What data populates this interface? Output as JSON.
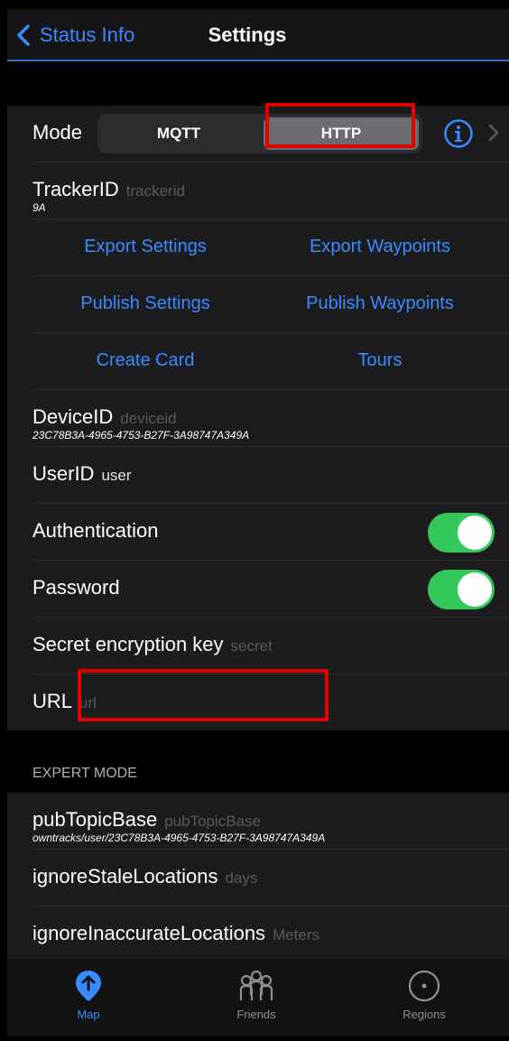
{
  "nav": {
    "back_label": "Status Info",
    "title": "Settings"
  },
  "mode": {
    "label": "Mode",
    "options": [
      "MQTT",
      "HTTP"
    ],
    "selected": "HTTP"
  },
  "tracker": {
    "label": "TrackerID",
    "placeholder": "trackerid",
    "value": "9A"
  },
  "buttons": {
    "export_settings": "Export Settings",
    "export_waypoints": "Export Waypoints",
    "publish_settings": "Publish Settings",
    "publish_waypoints": "Publish Waypoints",
    "create_card": "Create Card",
    "tours": "Tours"
  },
  "device": {
    "label": "DeviceID",
    "placeholder": "deviceid",
    "value": "23C78B3A-4965-4753-B27F-3A98747A349A"
  },
  "user": {
    "label": "UserID",
    "value": "user"
  },
  "authentication": {
    "label": "Authentication",
    "on": true
  },
  "password": {
    "label": "Password",
    "on": true
  },
  "secret": {
    "label": "Secret encryption key",
    "placeholder": "secret"
  },
  "url": {
    "label": "URL",
    "placeholder": "url"
  },
  "expert": {
    "header": "EXPERT MODE",
    "pub_topic": {
      "label": "pubTopicBase",
      "placeholder": "pubTopicBase",
      "value": "owntracks/user/23C78B3A-4965-4753-B27F-3A98747A349A"
    },
    "stale": {
      "label": "ignoreStaleLocations",
      "placeholder": "days"
    },
    "inaccurate": {
      "label": "ignoreInaccurateLocations",
      "placeholder": "Meters"
    }
  },
  "tabs": [
    {
      "label": "Map",
      "icon": "map-pin-icon",
      "active": true
    },
    {
      "label": "Friends",
      "icon": "friends-icon",
      "active": false
    },
    {
      "label": "Regions",
      "icon": "regions-icon",
      "active": false
    }
  ],
  "colors": {
    "accent": "#3a8bff",
    "toggle_on": "#34c759",
    "highlight": "#e00000"
  }
}
